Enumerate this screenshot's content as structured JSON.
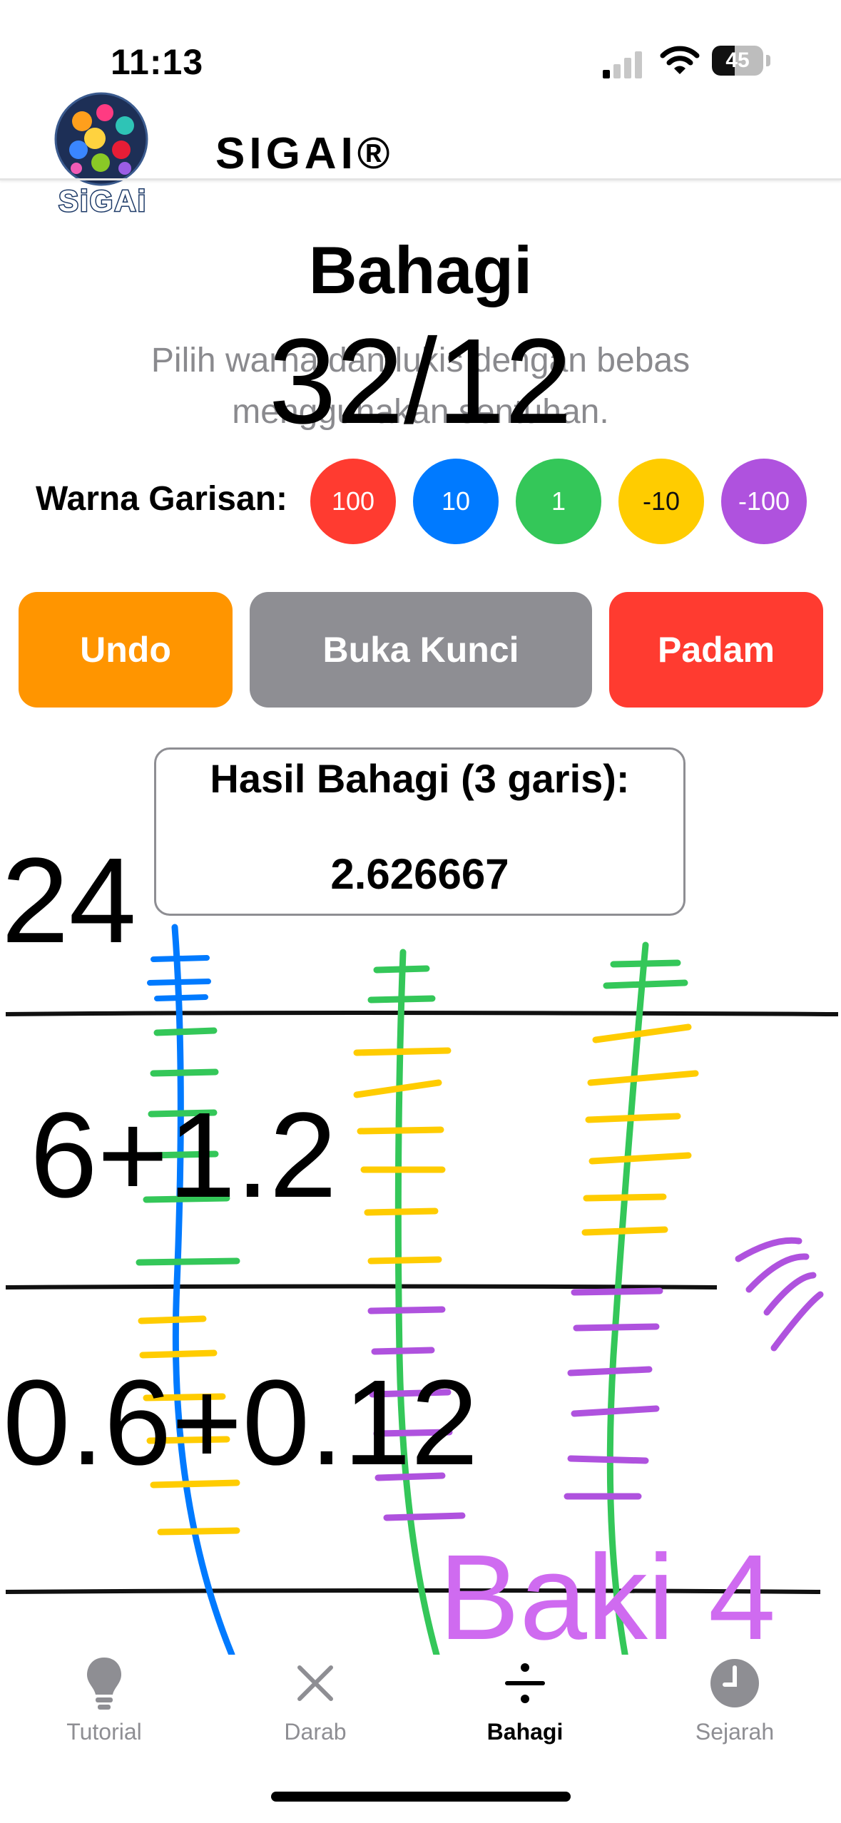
{
  "status_bar": {
    "time": "11:13",
    "battery": "45",
    "battery_level": 0.45
  },
  "header": {
    "logo_text": "SiGAi",
    "app_title": "SIGAI®"
  },
  "page": {
    "title": "Bahagi",
    "instruction": "Pilih warna dan lukis dengan bebas menggunakan sentuhan.",
    "problem": "32/12"
  },
  "colors": {
    "label": "Warna Garisan:",
    "options": [
      {
        "label": "100",
        "color": "#ff3b30"
      },
      {
        "label": "10",
        "color": "#007aff"
      },
      {
        "label": "1",
        "color": "#34c759"
      },
      {
        "label": "-10",
        "color": "#ffcc00"
      },
      {
        "label": "-100",
        "color": "#af52de"
      }
    ]
  },
  "actions": {
    "undo": "Undo",
    "unlock": "Buka Kunci",
    "delete": "Padam"
  },
  "result": {
    "title": "Hasil Bahagi (3 garis):",
    "value": "2.626667"
  },
  "canvas": {
    "row1": "24",
    "row2": "6+1.2",
    "row3": "0.6+0.12",
    "remainder": "Baki 4"
  },
  "tabs": [
    {
      "label": "Tutorial",
      "icon": "lightbulb-icon"
    },
    {
      "label": "Darab",
      "icon": "multiply-icon"
    },
    {
      "label": "Bahagi",
      "icon": "divide-icon",
      "active": true
    },
    {
      "label": "Sejarah",
      "icon": "clock-icon"
    }
  ]
}
